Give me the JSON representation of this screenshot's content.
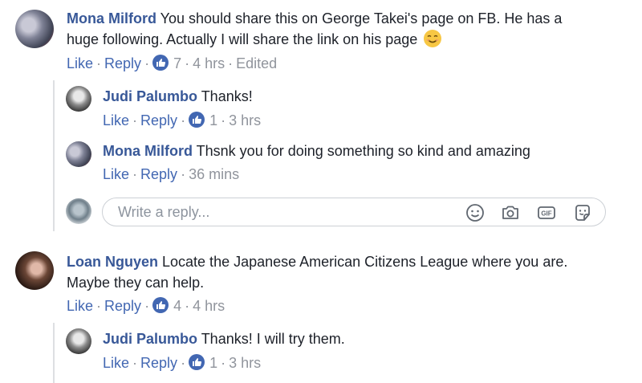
{
  "comments": [
    {
      "author": "Mona Milford",
      "text": " You should share this on George Takei's page on FB. He has a",
      "text2": "huge following. Actually I will share the link on his page",
      "emoji": "smiling-face-icon",
      "like": "Like",
      "reply": "Reply",
      "reactions": "7",
      "time": "4 hrs",
      "edited": "Edited"
    },
    {
      "author": "Judi Palumbo",
      "text": " Thanks!",
      "like": "Like",
      "reply": "Reply",
      "reactions": "1",
      "time": "3 hrs"
    },
    {
      "author": "Mona Milford",
      "text": " Thsnk you for doing something so kind and amazing",
      "like": "Like",
      "reply": "Reply",
      "time": "36 mins"
    },
    {
      "author": "Loan Nguyen",
      "text": " Locate the Japanese American Citizens League where you are.",
      "text2": "Maybe they can help.",
      "like": "Like",
      "reply": "Reply",
      "reactions": "4",
      "time": "4 hrs"
    },
    {
      "author": "Judi Palumbo",
      "text": " Thanks! I will try them.",
      "like": "Like",
      "reply": "Reply",
      "reactions": "1",
      "time": "3 hrs"
    }
  ],
  "reply_box": {
    "placeholder": "Write a reply...",
    "icons": [
      "emoji-icon",
      "camera-icon",
      "gif-icon",
      "sticker-icon"
    ]
  },
  "colors": {
    "author": "#385898",
    "link": "#4267b2",
    "meta": "#90949c",
    "like_badge": "#4267b2"
  }
}
